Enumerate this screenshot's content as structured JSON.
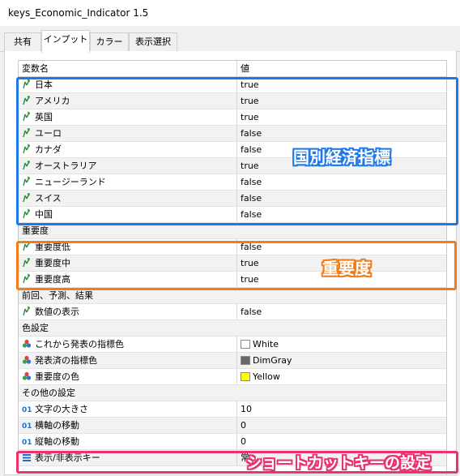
{
  "window": {
    "title": "keys_Economic_Indicator 1.5"
  },
  "tabs": [
    {
      "label": "共有"
    },
    {
      "label": "インプット"
    },
    {
      "label": "カラー"
    },
    {
      "label": "表示選択"
    }
  ],
  "grid": {
    "header": {
      "name": "変数名",
      "value": "値"
    },
    "countries": [
      {
        "name": "日本",
        "value": "true"
      },
      {
        "name": "アメリカ",
        "value": "true"
      },
      {
        "name": "英国",
        "value": "true"
      },
      {
        "name": "ユーロ",
        "value": "false"
      },
      {
        "name": "カナダ",
        "value": "false"
      },
      {
        "name": "オーストラリア",
        "value": "true"
      },
      {
        "name": "ニュージーランド",
        "value": "false"
      },
      {
        "name": "スイス",
        "value": "false"
      },
      {
        "name": "中国",
        "value": "false"
      }
    ],
    "importance_group": "重要度",
    "importance": [
      {
        "name": "重要度低",
        "value": "false"
      },
      {
        "name": "重要度中",
        "value": "true"
      },
      {
        "name": "重要度高",
        "value": "true"
      }
    ],
    "forecast_group": "前回、予測、結果",
    "forecast": [
      {
        "name": "数値の表示",
        "value": "false"
      }
    ],
    "color_group": "色設定",
    "colors": [
      {
        "name": "これから発表の指標色",
        "value": "White",
        "swatch": "#ffffff"
      },
      {
        "name": "発表済の指標色",
        "value": "DimGray",
        "swatch": "#696969"
      },
      {
        "name": "重要度の色",
        "value": "Yellow",
        "swatch": "#ffff00"
      }
    ],
    "other_group": "その他の設定",
    "other": [
      {
        "name": "文字の大きさ",
        "value": "10"
      },
      {
        "name": "横軸の移動",
        "value": "0"
      },
      {
        "name": "縦軸の移動",
        "value": "0"
      },
      {
        "name": "表示/非表示キー",
        "value": "常"
      }
    ]
  },
  "annotations": {
    "countries": "国別経済指標",
    "importance": "重要度",
    "shortcut": "ショートカットキーの設定"
  },
  "colors": {
    "blue_box": "#1f78e6",
    "orange_box": "#f07d1a",
    "pink_box": "#e8336f",
    "bool_icon": "#2e8b3a",
    "number_icon": "#1f6fc4"
  }
}
